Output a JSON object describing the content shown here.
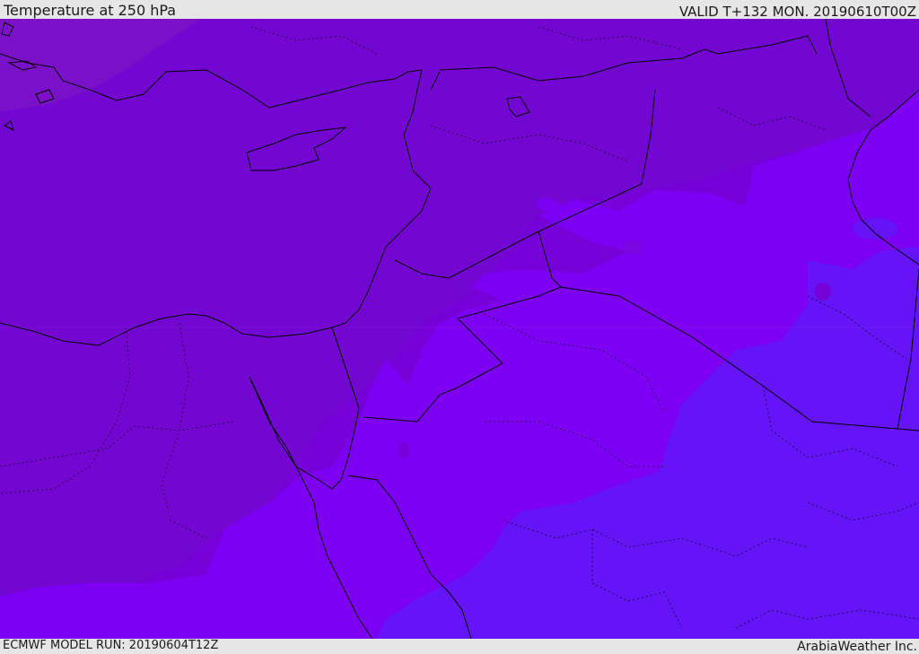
{
  "header": {
    "title": "Temperature at 250 hPa",
    "valid_time": "VALID T+132 MON. 20190610T00Z"
  },
  "footer": {
    "model_run": "ECMWF MODEL RUN: 20190604T12Z",
    "credit": "ArabiaWeather Inc."
  },
  "colors": {
    "frame": "#e6e6e6",
    "coldest_band": "#7a10c8",
    "mid_band": "#7600d8",
    "warm_band": "#7d00f4",
    "warmest_band": "#6414f6",
    "border_line": "#000000"
  }
}
